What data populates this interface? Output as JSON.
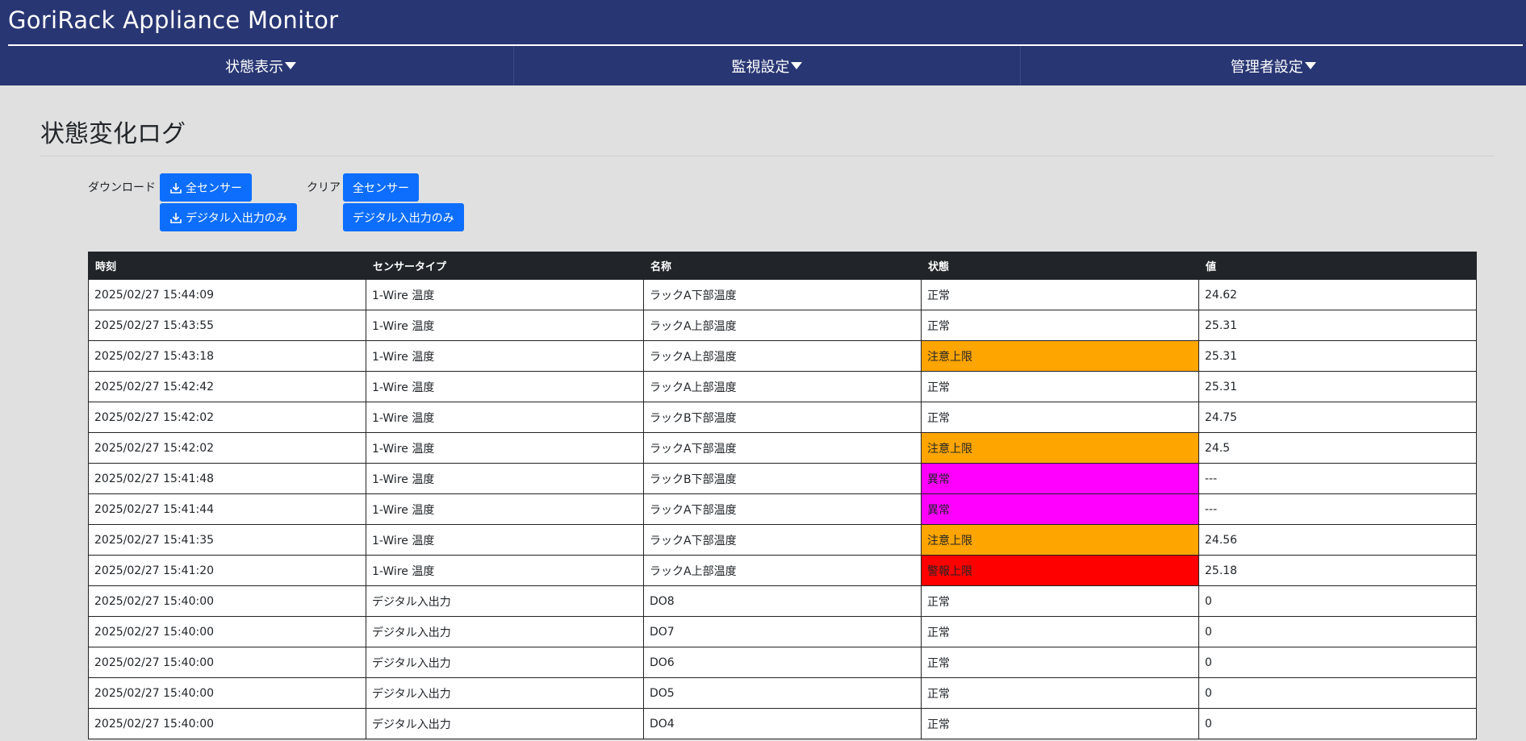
{
  "app": {
    "title": "GoriRack Appliance Monitor"
  },
  "nav": [
    {
      "label": "状態表示"
    },
    {
      "label": "監視設定"
    },
    {
      "label": "管理者設定"
    }
  ],
  "page": {
    "title": "状態変化ログ"
  },
  "download": {
    "label": "ダウンロード",
    "all_sensors": "全センサー",
    "digital_only": "デジタル入出力のみ"
  },
  "clear": {
    "label": "クリア",
    "all_sensors": "全センサー",
    "digital_only": "デジタル入出力のみ"
  },
  "table": {
    "columns": [
      "時刻",
      "センサータイプ",
      "名称",
      "状態",
      "値"
    ],
    "rows": [
      {
        "time": "2025/02/27 15:44:09",
        "type": "1-Wire 温度",
        "name": "ラックA下部温度",
        "status": "正常",
        "status_color": "#ffffff",
        "value": "24.62"
      },
      {
        "time": "2025/02/27 15:43:55",
        "type": "1-Wire 温度",
        "name": "ラックA上部温度",
        "status": "正常",
        "status_color": "#ffffff",
        "value": "25.31"
      },
      {
        "time": "2025/02/27 15:43:18",
        "type": "1-Wire 温度",
        "name": "ラックA上部温度",
        "status": "注意上限",
        "status_color": "#ffa500",
        "value": "25.31"
      },
      {
        "time": "2025/02/27 15:42:42",
        "type": "1-Wire 温度",
        "name": "ラックA上部温度",
        "status": "正常",
        "status_color": "#ffffff",
        "value": "25.31"
      },
      {
        "time": "2025/02/27 15:42:02",
        "type": "1-Wire 温度",
        "name": "ラックB下部温度",
        "status": "正常",
        "status_color": "#ffffff",
        "value": "24.75"
      },
      {
        "time": "2025/02/27 15:42:02",
        "type": "1-Wire 温度",
        "name": "ラックA下部温度",
        "status": "注意上限",
        "status_color": "#ffa500",
        "value": "24.5"
      },
      {
        "time": "2025/02/27 15:41:48",
        "type": "1-Wire 温度",
        "name": "ラックB下部温度",
        "status": "異常",
        "status_color": "#ff00ff",
        "value": "---"
      },
      {
        "time": "2025/02/27 15:41:44",
        "type": "1-Wire 温度",
        "name": "ラックA下部温度",
        "status": "異常",
        "status_color": "#ff00ff",
        "value": "---"
      },
      {
        "time": "2025/02/27 15:41:35",
        "type": "1-Wire 温度",
        "name": "ラックA下部温度",
        "status": "注意上限",
        "status_color": "#ffa500",
        "value": "24.56"
      },
      {
        "time": "2025/02/27 15:41:20",
        "type": "1-Wire 温度",
        "name": "ラックA上部温度",
        "status": "警報上限",
        "status_color": "#ff0000",
        "value": "25.18"
      },
      {
        "time": "2025/02/27 15:40:00",
        "type": "デジタル入出力",
        "name": "DO8",
        "status": "正常",
        "status_color": "#ffffff",
        "value": "0"
      },
      {
        "time": "2025/02/27 15:40:00",
        "type": "デジタル入出力",
        "name": "DO7",
        "status": "正常",
        "status_color": "#ffffff",
        "value": "0"
      },
      {
        "time": "2025/02/27 15:40:00",
        "type": "デジタル入出力",
        "name": "DO6",
        "status": "正常",
        "status_color": "#ffffff",
        "value": "0"
      },
      {
        "time": "2025/02/27 15:40:00",
        "type": "デジタル入出力",
        "name": "DO5",
        "status": "正常",
        "status_color": "#ffffff",
        "value": "0"
      },
      {
        "time": "2025/02/27 15:40:00",
        "type": "デジタル入出力",
        "name": "DO4",
        "status": "正常",
        "status_color": "#ffffff",
        "value": "0"
      }
    ]
  },
  "colors": {
    "header_bg": "#283673",
    "button_bg": "#0d6efd",
    "caution": "#ffa500",
    "error": "#ff00ff",
    "alarm": "#ff0000"
  }
}
